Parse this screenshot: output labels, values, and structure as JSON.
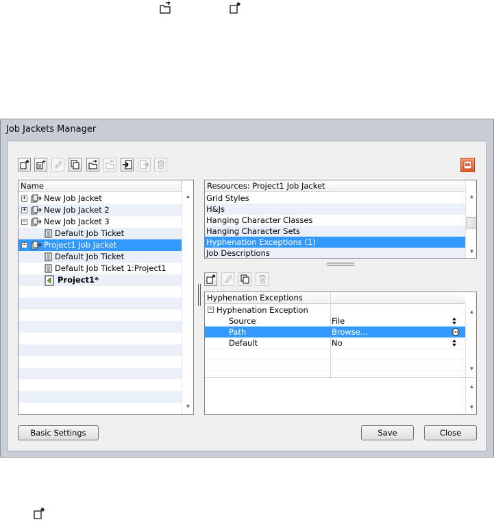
{
  "window": {
    "title": "Job Jackets Manager"
  },
  "toolbar": {
    "buttons": [
      {
        "name": "new-job-jacket-button",
        "icon": "new-doc-icon",
        "enabled": true
      },
      {
        "name": "new-job-ticket-button",
        "icon": "new-ticket-icon",
        "enabled": true
      },
      {
        "name": "edit-button",
        "icon": "pencil-icon",
        "enabled": false
      },
      {
        "name": "duplicate-button",
        "icon": "duplicate-icon",
        "enabled": true
      },
      {
        "name": "open-button",
        "icon": "open-folder-icon",
        "enabled": true
      },
      {
        "name": "close-jacket-button",
        "icon": "close-folder-icon",
        "enabled": false
      },
      {
        "name": "import-button",
        "icon": "import-icon",
        "enabled": true
      },
      {
        "name": "export-button",
        "icon": "export-icon",
        "enabled": false
      },
      {
        "name": "delete-button",
        "icon": "trash-icon",
        "enabled": false
      }
    ],
    "report_icon": "report-icon"
  },
  "tree": {
    "header": "Name",
    "items": [
      {
        "label": "New Job Jacket",
        "expander": "+",
        "icon": "jacket-icon"
      },
      {
        "label": "New Job Jacket 2",
        "expander": "+",
        "icon": "jacket-icon"
      },
      {
        "label": "New Job Jacket 3",
        "expander": "−",
        "icon": "jacket-icon"
      },
      {
        "label": "Default Job Ticket",
        "icon": "ticket-icon"
      },
      {
        "label": "Project1 Job Jacket",
        "expander": "−",
        "icon": "jacket-icon",
        "selected": true
      },
      {
        "label": "Default Job Ticket",
        "icon": "ticket-icon"
      },
      {
        "label": "Default Job Ticket 1:Project1",
        "icon": "ticket-icon"
      },
      {
        "label": "Project1*",
        "icon": "project-icon",
        "bold": true
      }
    ]
  },
  "resources": {
    "header": "Resources: Project1 Job Jacket",
    "items": [
      {
        "label": "Grid Styles"
      },
      {
        "label": "H&Js"
      },
      {
        "label": "Hanging Character Classes"
      },
      {
        "label": "Hanging Character Sets"
      },
      {
        "label": "Hyphenation Exceptions (1)",
        "selected": true
      },
      {
        "label": "Job Descriptions"
      }
    ]
  },
  "detail": {
    "header_col1": "Hyphenation Exceptions",
    "group": "Hyphenation Exception",
    "rows": [
      {
        "name": "Source",
        "value": "File",
        "control": "spinner-icon"
      },
      {
        "name": "Path",
        "value": "Browse...",
        "control": "ellipsis-icon",
        "selected": true
      },
      {
        "name": "Default",
        "value": "No",
        "control": "spinner-icon"
      }
    ]
  },
  "buttons": {
    "basic_settings": "Basic Settings",
    "save": "Save",
    "close": "Close"
  },
  "colors": {
    "selection": "#3399ff",
    "stripe": "#e9f0fa",
    "report_icon": "#e8663c"
  }
}
